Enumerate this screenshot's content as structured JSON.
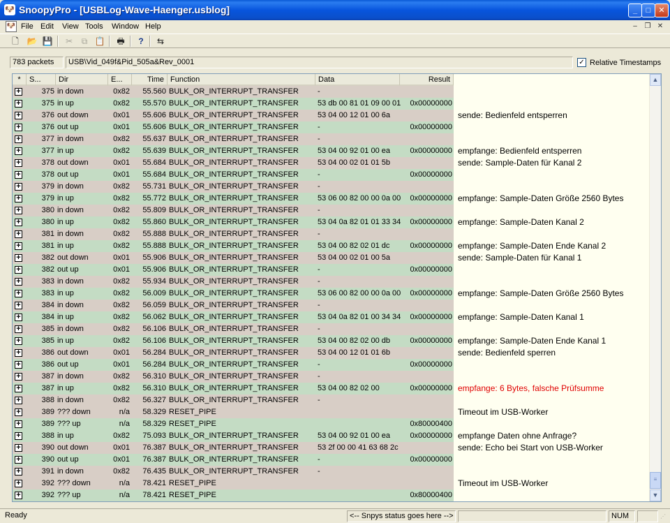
{
  "window": {
    "app_icon": "snoopy-icon",
    "title": "SnoopyPro - [USBLog-Wave-Haenger.usblog]"
  },
  "menu": {
    "items": [
      "File",
      "Edit",
      "View",
      "Tools",
      "Window",
      "Help"
    ]
  },
  "toolbar": {
    "buttons": [
      "new-icon",
      "open-icon",
      "save-icon",
      "cut-icon",
      "copy-icon",
      "paste-icon",
      "print-icon",
      "help-icon",
      "usb-icon"
    ]
  },
  "info": {
    "packets": "783 packets",
    "device": "USB\\Vid_049f&Pid_505a&Rev_0001",
    "relative_timestamps_label": "Relative Timestamps",
    "relative_timestamps_checked": true
  },
  "columns": {
    "star": "*",
    "seq": "S...",
    "dir": "Dir",
    "ep": "E...",
    "time": "Time",
    "function": "Function",
    "data": "Data",
    "result": "Result"
  },
  "colors": {
    "down_row": "#d8cec6",
    "up_row": "#c4dcc4",
    "note_bg": "#fffff0",
    "error_text": "#e00000"
  },
  "rows": [
    {
      "seq": "375",
      "dir": "in down",
      "ep": "0x82",
      "time": "55.560",
      "fn": "BULK_OR_INTERRUPT_TRANSFER",
      "data": "-",
      "result": "",
      "note": "",
      "kind": "down"
    },
    {
      "seq": "375",
      "dir": "in up",
      "ep": "0x82",
      "time": "55.570",
      "fn": "BULK_OR_INTERRUPT_TRANSFER",
      "data": "53 db 00 81 01 09 00 01",
      "result": "0x00000000",
      "note": "",
      "kind": "up"
    },
    {
      "seq": "376",
      "dir": "out down",
      "ep": "0x01",
      "time": "55.606",
      "fn": "BULK_OR_INTERRUPT_TRANSFER",
      "data": "53 04 00 12 01 00 6a",
      "result": "",
      "note": "sende: Bedienfeld entsperren",
      "kind": "down"
    },
    {
      "seq": "376",
      "dir": "out up",
      "ep": "0x01",
      "time": "55.606",
      "fn": "BULK_OR_INTERRUPT_TRANSFER",
      "data": "-",
      "result": "0x00000000",
      "note": "",
      "kind": "up"
    },
    {
      "seq": "377",
      "dir": "in down",
      "ep": "0x82",
      "time": "55.637",
      "fn": "BULK_OR_INTERRUPT_TRANSFER",
      "data": "-",
      "result": "",
      "note": "",
      "kind": "down"
    },
    {
      "seq": "377",
      "dir": "in up",
      "ep": "0x82",
      "time": "55.639",
      "fn": "BULK_OR_INTERRUPT_TRANSFER",
      "data": "53 04 00 92 01 00 ea",
      "result": "0x00000000",
      "note": "empfange: Bedienfeld entsperren",
      "kind": "up"
    },
    {
      "seq": "378",
      "dir": "out down",
      "ep": "0x01",
      "time": "55.684",
      "fn": "BULK_OR_INTERRUPT_TRANSFER",
      "data": "53 04 00 02 01 01 5b",
      "result": "",
      "note": "sende: Sample-Daten für Kanal 2",
      "kind": "down"
    },
    {
      "seq": "378",
      "dir": "out up",
      "ep": "0x01",
      "time": "55.684",
      "fn": "BULK_OR_INTERRUPT_TRANSFER",
      "data": "-",
      "result": "0x00000000",
      "note": "",
      "kind": "up"
    },
    {
      "seq": "379",
      "dir": "in down",
      "ep": "0x82",
      "time": "55.731",
      "fn": "BULK_OR_INTERRUPT_TRANSFER",
      "data": "-",
      "result": "",
      "note": "",
      "kind": "down"
    },
    {
      "seq": "379",
      "dir": "in up",
      "ep": "0x82",
      "time": "55.772",
      "fn": "BULK_OR_INTERRUPT_TRANSFER",
      "data": "53 06 00 82 00 00 0a 00",
      "result": "0x00000000",
      "note": "empfange: Sample-Daten Größe 2560 Bytes",
      "kind": "up"
    },
    {
      "seq": "380",
      "dir": "in down",
      "ep": "0x82",
      "time": "55.809",
      "fn": "BULK_OR_INTERRUPT_TRANSFER",
      "data": "-",
      "result": "",
      "note": "",
      "kind": "down"
    },
    {
      "seq": "380",
      "dir": "in up",
      "ep": "0x82",
      "time": "55.860",
      "fn": "BULK_OR_INTERRUPT_TRANSFER",
      "data": "53 04 0a 82 01 01 33 34",
      "result": "0x00000000",
      "note": "empfange: Sample-Daten Kanal 2",
      "kind": "up"
    },
    {
      "seq": "381",
      "dir": "in down",
      "ep": "0x82",
      "time": "55.888",
      "fn": "BULK_OR_INTERRUPT_TRANSFER",
      "data": "-",
      "result": "",
      "note": "",
      "kind": "down"
    },
    {
      "seq": "381",
      "dir": "in up",
      "ep": "0x82",
      "time": "55.888",
      "fn": "BULK_OR_INTERRUPT_TRANSFER",
      "data": "53 04 00 82 02 01 dc",
      "result": "0x00000000",
      "note": "empfange: Sample-Daten Ende Kanal 2",
      "kind": "up"
    },
    {
      "seq": "382",
      "dir": "out down",
      "ep": "0x01",
      "time": "55.906",
      "fn": "BULK_OR_INTERRUPT_TRANSFER",
      "data": "53 04 00 02 01 00 5a",
      "result": "",
      "note": "sende: Sample-Daten für Kanal 1",
      "kind": "down"
    },
    {
      "seq": "382",
      "dir": "out up",
      "ep": "0x01",
      "time": "55.906",
      "fn": "BULK_OR_INTERRUPT_TRANSFER",
      "data": "-",
      "result": "0x00000000",
      "note": "",
      "kind": "up"
    },
    {
      "seq": "383",
      "dir": "in down",
      "ep": "0x82",
      "time": "55.934",
      "fn": "BULK_OR_INTERRUPT_TRANSFER",
      "data": "-",
      "result": "",
      "note": "",
      "kind": "down"
    },
    {
      "seq": "383",
      "dir": "in up",
      "ep": "0x82",
      "time": "56.009",
      "fn": "BULK_OR_INTERRUPT_TRANSFER",
      "data": "53 06 00 82 00 00 0a 00",
      "result": "0x00000000",
      "note": "empfange: Sample-Daten Größe 2560 Bytes",
      "kind": "up"
    },
    {
      "seq": "384",
      "dir": "in down",
      "ep": "0x82",
      "time": "56.059",
      "fn": "BULK_OR_INTERRUPT_TRANSFER",
      "data": "-",
      "result": "",
      "note": "",
      "kind": "down"
    },
    {
      "seq": "384",
      "dir": "in up",
      "ep": "0x82",
      "time": "56.062",
      "fn": "BULK_OR_INTERRUPT_TRANSFER",
      "data": "53 04 0a 82 01 00 34 34",
      "result": "0x00000000",
      "note": "empfange: Sample-Daten Kanal 1",
      "kind": "up"
    },
    {
      "seq": "385",
      "dir": "in down",
      "ep": "0x82",
      "time": "56.106",
      "fn": "BULK_OR_INTERRUPT_TRANSFER",
      "data": "-",
      "result": "",
      "note": "",
      "kind": "down"
    },
    {
      "seq": "385",
      "dir": "in up",
      "ep": "0x82",
      "time": "56.106",
      "fn": "BULK_OR_INTERRUPT_TRANSFER",
      "data": "53 04 00 82 02 00 db",
      "result": "0x00000000",
      "note": "empfange: Sample-Daten Ende Kanal 1",
      "kind": "up"
    },
    {
      "seq": "386",
      "dir": "out down",
      "ep": "0x01",
      "time": "56.284",
      "fn": "BULK_OR_INTERRUPT_TRANSFER",
      "data": "53 04 00 12 01 01 6b",
      "result": "",
      "note": "sende: Bedienfeld sperren",
      "kind": "down"
    },
    {
      "seq": "386",
      "dir": "out up",
      "ep": "0x01",
      "time": "56.284",
      "fn": "BULK_OR_INTERRUPT_TRANSFER",
      "data": "-",
      "result": "0x00000000",
      "note": "",
      "kind": "up"
    },
    {
      "seq": "387",
      "dir": "in down",
      "ep": "0x82",
      "time": "56.310",
      "fn": "BULK_OR_INTERRUPT_TRANSFER",
      "data": "-",
      "result": "",
      "note": "",
      "kind": "down"
    },
    {
      "seq": "387",
      "dir": "in up",
      "ep": "0x82",
      "time": "56.310",
      "fn": "BULK_OR_INTERRUPT_TRANSFER",
      "data": "53 04 00 82 02 00",
      "result": "0x00000000",
      "note": "empfange: 6 Bytes, falsche Prüfsumme",
      "kind": "up",
      "note_error": true
    },
    {
      "seq": "388",
      "dir": "in down",
      "ep": "0x82",
      "time": "56.327",
      "fn": "BULK_OR_INTERRUPT_TRANSFER",
      "data": "-",
      "result": "",
      "note": "",
      "kind": "down"
    },
    {
      "seq": "389",
      "dir": "??? down",
      "ep": "n/a",
      "time": "58.329",
      "fn": "RESET_PIPE",
      "data": "",
      "result": "",
      "note": "Timeout im USB-Worker",
      "kind": "down"
    },
    {
      "seq": "389",
      "dir": "??? up",
      "ep": "n/a",
      "time": "58.329",
      "fn": "RESET_PIPE",
      "data": "",
      "result": "0x80000400",
      "note": "",
      "kind": "up"
    },
    {
      "seq": "388",
      "dir": "in up",
      "ep": "0x82",
      "time": "75.093",
      "fn": "BULK_OR_INTERRUPT_TRANSFER",
      "data": "53 04 00 92 01 00 ea",
      "result": "0x00000000",
      "note": "empfange Daten ohne Anfrage?",
      "kind": "up"
    },
    {
      "seq": "390",
      "dir": "out down",
      "ep": "0x01",
      "time": "76.387",
      "fn": "BULK_OR_INTERRUPT_TRANSFER",
      "data": "53 2f 00 00 41 63 68 2c",
      "result": "",
      "note": "sende: Echo bei Start von USB-Worker",
      "kind": "down"
    },
    {
      "seq": "390",
      "dir": "out up",
      "ep": "0x01",
      "time": "76.387",
      "fn": "BULK_OR_INTERRUPT_TRANSFER",
      "data": "-",
      "result": "0x00000000",
      "note": "",
      "kind": "up"
    },
    {
      "seq": "391",
      "dir": "in down",
      "ep": "0x82",
      "time": "76.435",
      "fn": "BULK_OR_INTERRUPT_TRANSFER",
      "data": "-",
      "result": "",
      "note": "",
      "kind": "down"
    },
    {
      "seq": "392",
      "dir": "??? down",
      "ep": "n/a",
      "time": "78.421",
      "fn": "RESET_PIPE",
      "data": "",
      "result": "",
      "note": "Timeout im USB-Worker",
      "kind": "down"
    },
    {
      "seq": "392",
      "dir": "??? up",
      "ep": "n/a",
      "time": "78.421",
      "fn": "RESET_PIPE",
      "data": "",
      "result": "0x80000400",
      "note": "",
      "kind": "up"
    }
  ],
  "status": {
    "ready": "Ready",
    "snpys": "<-- Snpys status goes here -->",
    "num": "NUM"
  }
}
